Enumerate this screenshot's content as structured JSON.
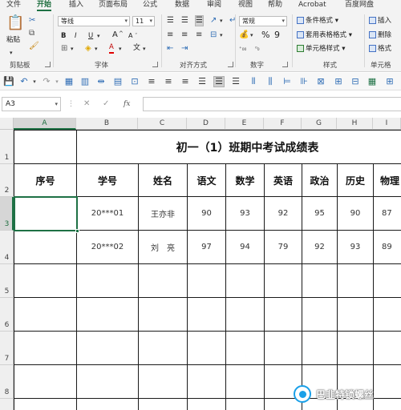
{
  "ribbon": {
    "tabs": [
      "文件",
      "开始",
      "插入",
      "页面布局",
      "公式",
      "数据",
      "审阅",
      "视图",
      "帮助",
      "Acrobat",
      "百度网盘"
    ],
    "active_tab": "开始",
    "clipboard": {
      "paste": "粘贴",
      "group": "剪贴板"
    },
    "font": {
      "name": "等线",
      "size": "11",
      "group": "字体",
      "bold": "B",
      "italic": "I",
      "underline": "U",
      "grow": "A",
      "shrink": "A",
      "color_letter": "A",
      "phonetic": "文"
    },
    "alignment": {
      "group": "对齐方式"
    },
    "number": {
      "format": "常规",
      "percent": "%",
      "comma": "9",
      "group": "数字"
    },
    "styles": {
      "conditional": "条件格式",
      "table": "套用表格格式",
      "cell": "单元格样式",
      "group": "样式"
    },
    "cells": {
      "insert": "插入",
      "delete": "删除",
      "format": "格式",
      "group": "单元格"
    }
  },
  "formula_bar": {
    "name_box": "A3",
    "fx": "fx",
    "cancel": "✕",
    "enter": "✓",
    "value": ""
  },
  "columns": [
    "A",
    "B",
    "C",
    "D",
    "E",
    "F",
    "G",
    "H",
    "I"
  ],
  "rows": [
    "1",
    "2",
    "3",
    "4",
    "5",
    "6",
    "7",
    "8"
  ],
  "sheet": {
    "title": "初一（1）班期中考试成绩表",
    "headers": [
      "序号",
      "学号",
      "姓名",
      "语文",
      "数学",
      "英语",
      "政治",
      "历史",
      "物理"
    ],
    "records": [
      [
        "",
        "20***01",
        "王亦非",
        "90",
        "93",
        "92",
        "95",
        "90",
        "87"
      ],
      [
        "",
        "20***02",
        "刘　亮",
        "97",
        "94",
        "79",
        "92",
        "93",
        "89"
      ]
    ]
  },
  "selected_cell": "A3",
  "watermark": "巴韭特锁螺丝"
}
